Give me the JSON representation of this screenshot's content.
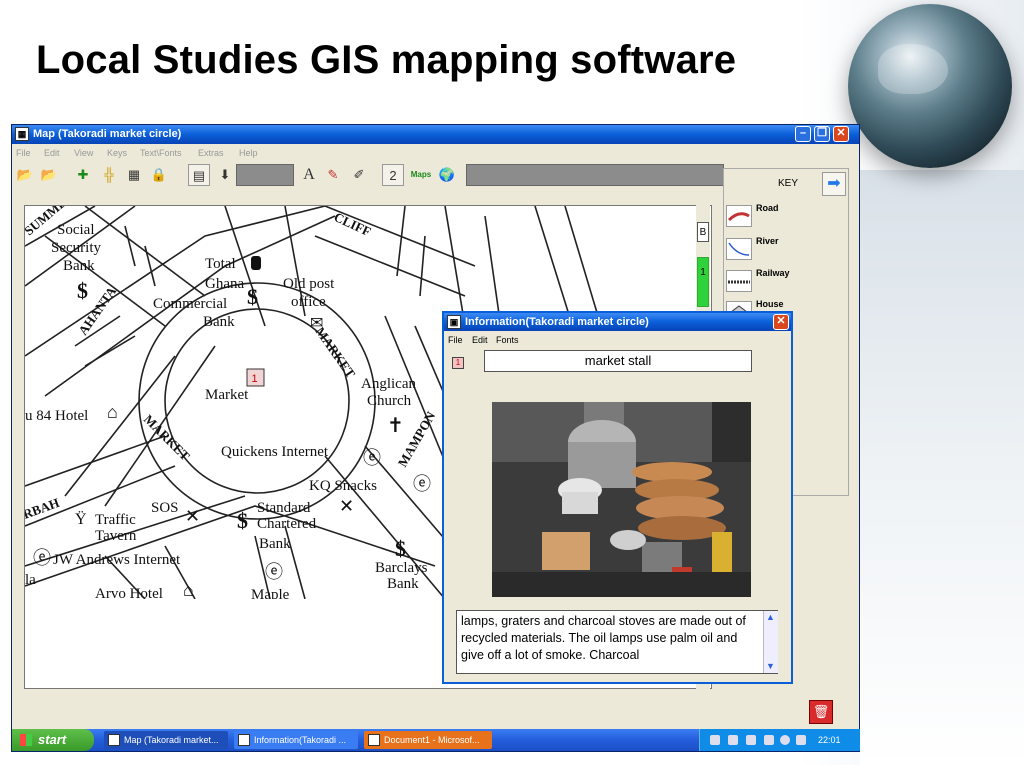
{
  "slide": {
    "title": "Local Studies GIS mapping software"
  },
  "map_window": {
    "title": "Map (Takoradi market circle)",
    "menu": [
      "File",
      "Edit",
      "View",
      "Keys",
      "Text\\Fonts",
      "Extras",
      "Help"
    ],
    "toolbar": {
      "text_tool": "A",
      "page_number": "2",
      "maps_label": "Maps"
    },
    "scroll_markers": {
      "b": "B",
      "one": "1"
    },
    "map": {
      "street_labels": [
        "SUMME",
        "CLIFF",
        "AHANTA",
        "MARKET",
        "MARKET",
        "MAMPON",
        "RBAH"
      ],
      "place_labels": [
        "Social",
        "Security",
        "Bank",
        "Total",
        "Ghana",
        "Commercial",
        "Bank",
        "Old post",
        "office",
        "Market",
        "Anglican",
        "Church",
        "u 84 Hotel",
        "Quickens Internet",
        "KQ Snacks",
        "SOS",
        "Traffic",
        "Tavern",
        "Standard",
        "Chartered",
        "Bank",
        "JW Andrews Internet",
        "Barclays",
        "Bank",
        "la",
        "Arvo Hotel",
        "Maple"
      ],
      "marker_label": "1"
    }
  },
  "key_panel": {
    "title": "KEY",
    "items": [
      {
        "label": "Road"
      },
      {
        "label": "River"
      },
      {
        "label": "Railway"
      },
      {
        "label": "House"
      }
    ]
  },
  "info_window": {
    "title": "Information(Takoradi market circle)",
    "menu": [
      "File",
      "Edit",
      "Fonts"
    ],
    "badge": "1",
    "name": "market stall",
    "description": "lamps, graters and charcoal stoves are made out of recycled materials. The oil lamps use palm oil and give off a lot of smoke. Charcoal"
  },
  "taskbar": {
    "start_label": "start",
    "tasks": [
      {
        "label": "Map (Takoradi market..."
      },
      {
        "label": "Information(Takoradi ..."
      },
      {
        "label": "Document1 - Microsof..."
      }
    ],
    "clock": "22:01"
  },
  "colors": {
    "titlebar": "#0a5fd8",
    "taskbar": "#245edb",
    "start": "#3a9a2a",
    "key_arrow": "#2279e8",
    "road": "#c33333",
    "river": "#2a5bd8"
  }
}
